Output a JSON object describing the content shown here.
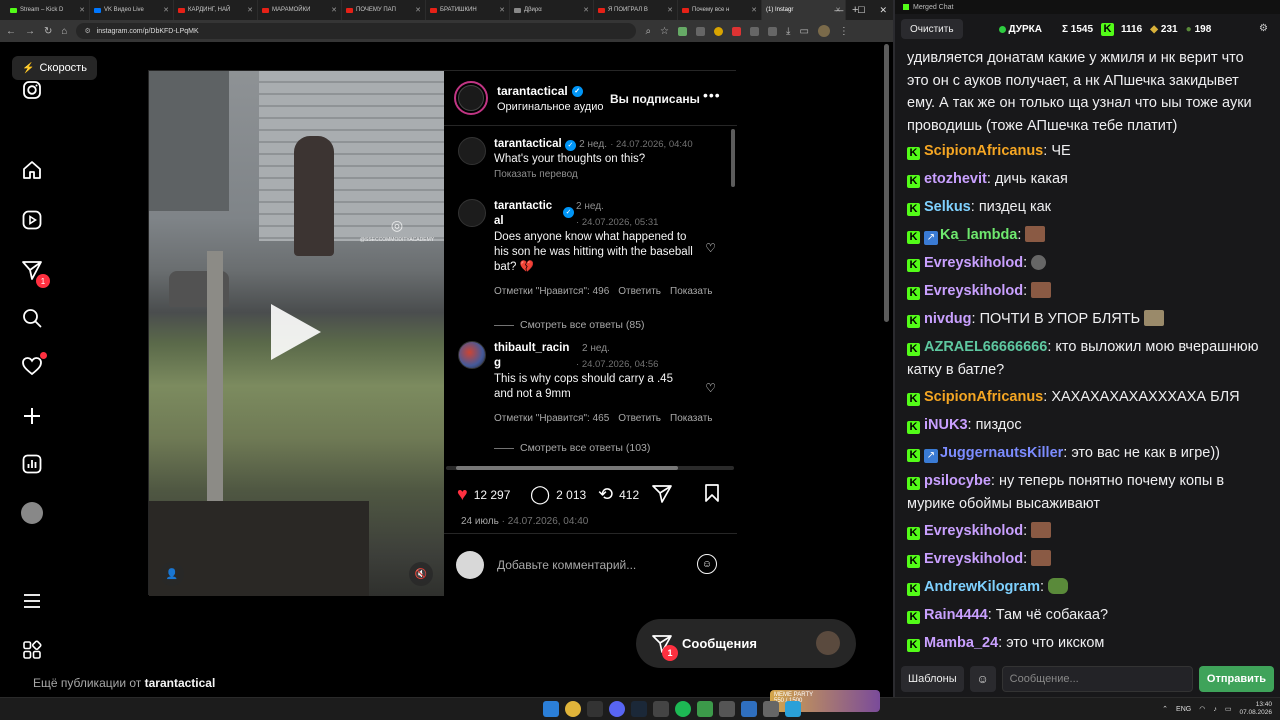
{
  "browser": {
    "tabs": [
      {
        "label": "Stream – Kick D",
        "icon": "kick"
      },
      {
        "label": "VK Видео Live",
        "icon": "vk"
      },
      {
        "label": "КАРДИНГ, НАЙ",
        "icon": "youtube"
      },
      {
        "label": "МАРАМОЙКИ",
        "icon": "youtube"
      },
      {
        "label": "ПОЧЕМУ ПАП",
        "icon": "youtube"
      },
      {
        "label": "БРАТИШКИН",
        "icon": "youtube"
      },
      {
        "label": "Дβиρα",
        "icon": "plain"
      },
      {
        "label": "Я ПОИГРАЛ В",
        "icon": "youtube"
      },
      {
        "label": "Почему все н",
        "icon": "youtube"
      },
      {
        "label": "(1) Instagr",
        "icon": "instagram"
      }
    ],
    "url": "instagram.com/p/DbKFD-LPqMK"
  },
  "instagram": {
    "speed_label": "Скорость",
    "nav_badge": "1",
    "messages_label": "Сообщения",
    "messages_badge": "1",
    "more_posts_prefix": "Ещё публикации от",
    "more_posts_user": "tarantactical",
    "post": {
      "username": "tarantactical",
      "audio": "Оригинальное аудио",
      "follow_state": "Вы подписаны",
      "watermark": "@SSECCOMMODITYACADEMY",
      "likes": "12 297",
      "comments_count": "2 013",
      "reposts": "412",
      "date_relative": "24 июль",
      "date_abs": "24.07.2026, 04:40",
      "add_comment_placeholder": "Добавьте комментарий...",
      "comments": [
        {
          "name": "tarantactical",
          "ago": "2 нед.",
          "date": "24.07.2026, 04:40",
          "text": "What's your thoughts on this?",
          "translate": "Показать перевод"
        },
        {
          "name_line1": "tarantactic",
          "name_line2": "al",
          "ago": "2 нед.",
          "date": "24.07.2026, 05:31",
          "text": "Does anyone know what happened to his son he was hitting with the baseball bat? 💔",
          "likes": "Отметки \"Нравится\": 496",
          "reply": "Ответить",
          "show": "Показать",
          "replies": "Смотреть все ответы (85)"
        },
        {
          "name_line1": "thibault_racin",
          "name_line2": "g",
          "ago": "2 нед.",
          "date": "24.07.2026, 04:56",
          "text": "This is why cops should carry a .45 and not a 9mm",
          "likes": "Отметки \"Нравится\": 465",
          "reply": "Ответить",
          "show": "Показать",
          "replies": "Смотреть все ответы (103)"
        }
      ]
    }
  },
  "chat": {
    "window_title": "Merged Chat",
    "clear_label": "Очистить",
    "channel": "ДУРКА",
    "stat_total": "Σ 1545",
    "stat_kick": "1116",
    "stat_other": "231",
    "stat_pepe": "198",
    "templates_label": "Шаблоны",
    "input_placeholder": "Сообщение...",
    "send_label": "Отправить",
    "prev_message": "удивляется донатам какие у жмиля и нк верит что это он с ауков получает, а нк АПшечка закидывет ему. А так же он только ща узнал что ыы тоже ауки проводишь (тоже АПшечка тебе платит)",
    "messages": [
      {
        "nick": "ScipionAfricanus",
        "color": "#f5a623",
        "text": "ЧЕ"
      },
      {
        "nick": "etozhevit",
        "color": "#c9a0ff",
        "text": "дичь какая"
      },
      {
        "nick": "Selkus",
        "color": "#7fd1ff",
        "text": "пиздец как"
      },
      {
        "nick": "Ka_lambda",
        "color": "#6ee86e",
        "text": "",
        "emote": "brown",
        "xbadge": true
      },
      {
        "nick": "Evreyskiholod",
        "color": "#c9a0ff",
        "text": "",
        "emote": "rock"
      },
      {
        "nick": "Evreyskiholod",
        "color": "#c9a0ff",
        "text": "",
        "emote": "brown"
      },
      {
        "nick": "nivdug",
        "color": "#c9a0ff",
        "text": "ПОЧТИ В УПОР БЛЯТЬ",
        "emote": "cat"
      },
      {
        "nick": "AZRAEL66666666",
        "color": "#5ec8a0",
        "text": "кто выложил мою вчерашнюю катку в батле?"
      },
      {
        "nick": "ScipionAfricanus",
        "color": "#f5a623",
        "text": "ХАХАХАХАХАХХХАХА БЛЯ"
      },
      {
        "nick": "iNUK3",
        "color": "#c9a0ff",
        "text": "пиздос"
      },
      {
        "nick": "JuggernautsKiller",
        "color": "#7c8cff",
        "text": "это вас не как в игре))",
        "xbadge": true
      },
      {
        "nick": "psilocybe",
        "color": "#c9a0ff",
        "text": "ну теперь понятно почему копы в мурике обоймы высаживают"
      },
      {
        "nick": "Evreyskiholod",
        "color": "#c9a0ff",
        "text": "",
        "emote": "brown"
      },
      {
        "nick": "Evreyskiholod",
        "color": "#c9a0ff",
        "text": "",
        "emote": "brown"
      },
      {
        "nick": "AndrewKilogram",
        "color": "#7fd1ff",
        "text": "",
        "emote": "frog"
      },
      {
        "nick": "Rain4444",
        "color": "#c9a0ff",
        "text": "Там чё собакаа?"
      },
      {
        "nick": "Mamba_24",
        "color": "#c9a0ff",
        "text": "это что икском"
      }
    ]
  },
  "taskbar": {
    "meme_label": "MEME PARTY",
    "meme_progress": "550 / 1500",
    "lang": "ENG",
    "time": "13:40",
    "date": "07.08.2026"
  }
}
